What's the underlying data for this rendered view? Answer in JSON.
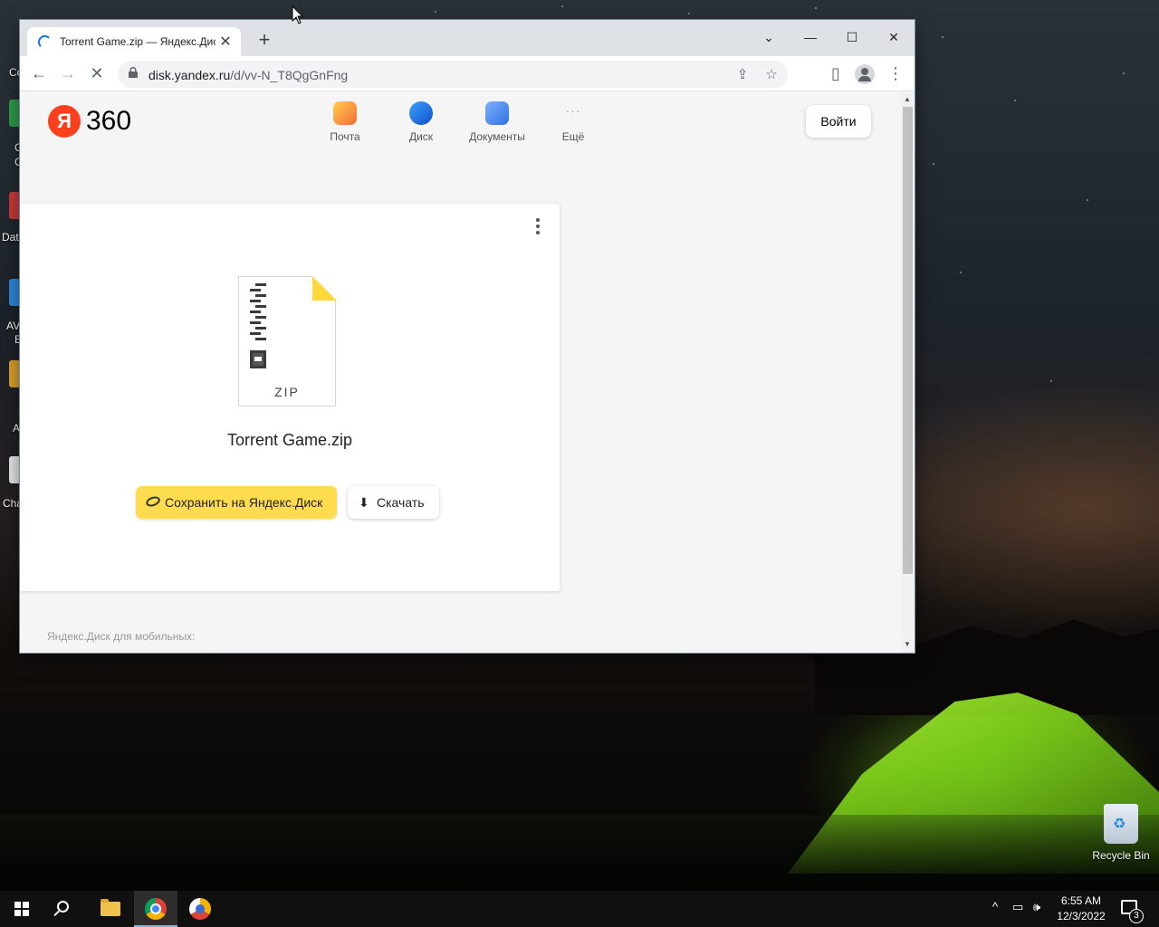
{
  "desktop": {
    "left_labels": [
      "Co",
      "C",
      "C",
      "Dat",
      "AV",
      "E",
      "A",
      "Cha"
    ],
    "recycle_bin_label": "Recycle Bin"
  },
  "browser": {
    "tab": {
      "title": "Torrent Game.zip — Яндекс.Диск",
      "close": "✕"
    },
    "new_tab": "+",
    "window_controls": {
      "tab_search": "⌄",
      "minimize": "—",
      "maximize": "☐",
      "close": "✕"
    },
    "toolbar": {
      "back": "←",
      "forward": "→",
      "stop": "✕",
      "menu": "⋮"
    },
    "omnibox": {
      "url_host": "disk.yandex.ru",
      "url_path": "/d/vv-N_T8QgGnFng",
      "share_icon": "⇪",
      "star_icon": "☆",
      "sidepanel_icon": "▯"
    }
  },
  "page": {
    "logo": {
      "letter": "Я",
      "text": "360"
    },
    "services": [
      {
        "label": "Почта",
        "color": "#f5a623"
      },
      {
        "label": "Диск",
        "color": "#1e6fe0"
      },
      {
        "label": "Документы",
        "color": "#4a8cf0"
      },
      {
        "label": "Ещё",
        "color": "#9e9e9e"
      }
    ],
    "more_icon": "···",
    "login_button": "Войти",
    "file": {
      "type_label": "ZIP",
      "name": "Torrent Game.zip"
    },
    "save_button": "Сохранить на Яндекс.Диск",
    "download_button": "Скачать",
    "footer": "Яндекс.Диск для мобильных:",
    "accent_color": "#ffdc4d",
    "logo_color": "#fc3f1d"
  },
  "taskbar": {
    "clock_time": "6:55 AM",
    "clock_date": "12/3/2022",
    "notification_count": "3",
    "tray_chevron": "^"
  }
}
